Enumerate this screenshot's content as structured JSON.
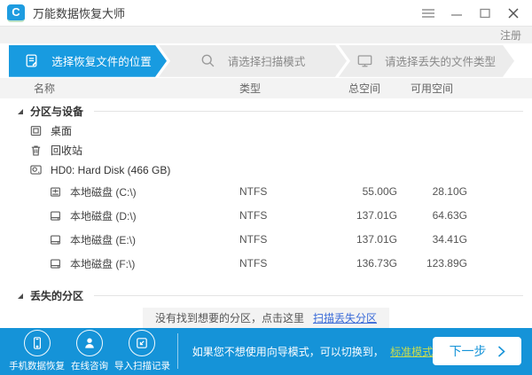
{
  "titlebar": {
    "app_title": "万能数据恢复大师"
  },
  "register": {
    "label": "注册"
  },
  "steps": [
    {
      "label": "选择恢复文件的位置",
      "icon": "document-edit-icon",
      "active": true
    },
    {
      "label": "请选择扫描模式",
      "icon": "search-icon",
      "active": false
    },
    {
      "label": "请选择丢失的文件类型",
      "icon": "monitor-icon",
      "active": false
    }
  ],
  "table": {
    "col_name": "名称",
    "col_type": "类型",
    "col_total": "总空间",
    "col_free": "可用空间"
  },
  "partitions": {
    "title": "分区与设备",
    "desktop": "桌面",
    "recycle": "回收站",
    "hd0": "HD0: Hard Disk (466 GB)",
    "drives": [
      {
        "name": "本地磁盘 (C:\\)",
        "type": "NTFS",
        "total": "55.00G",
        "free": "28.10G"
      },
      {
        "name": "本地磁盘 (D:\\)",
        "type": "NTFS",
        "total": "137.01G",
        "free": "64.63G"
      },
      {
        "name": "本地磁盘 (E:\\)",
        "type": "NTFS",
        "total": "137.01G",
        "free": "34.41G"
      },
      {
        "name": "本地磁盘 (F:\\)",
        "type": "NTFS",
        "total": "136.73G",
        "free": "123.89G"
      }
    ]
  },
  "lost": {
    "title": "丢失的分区",
    "notice": "没有找到想要的分区，点击这里",
    "scan_link": "扫描丢失分区"
  },
  "footer": {
    "phone_label": "手机数据恢复",
    "consult_label": "在线咨询",
    "import_label": "导入扫描记录",
    "mode_text": "如果您不想使用向导模式，可以切换到",
    "mode_link": "标准模式",
    "next_label": "下一步"
  },
  "colors": {
    "primary_blue": "#1593d8",
    "step_active_blue": "#189be0",
    "scan_link_blue": "#3a6bd8",
    "mode_link_green": "#c9dd4e"
  }
}
